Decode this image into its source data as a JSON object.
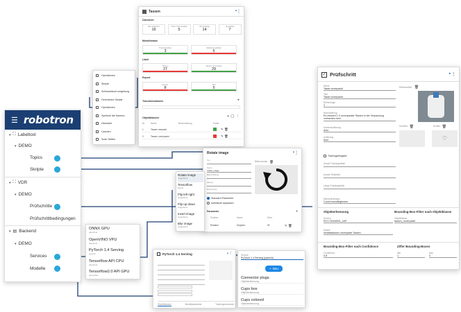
{
  "sidebar": {
    "brand": "robotron",
    "sections": [
      {
        "label": "Labeltool",
        "sub": "DEMO",
        "items": [
          "Topics",
          "Skripte"
        ]
      },
      {
        "label": "VDR",
        "sub": "DEMO",
        "items": [
          "Prüfschritte",
          "Prüfschrittbedingungen"
        ]
      },
      {
        "label": "Backend",
        "sub": "DEMO",
        "items": [
          "Services",
          "Modelle"
        ]
      }
    ]
  },
  "menu": {
    "items": [
      "Operationen",
      "Skripte",
      "Schlüsselwort umgebung",
      "Generische Skripte",
      "Operationen",
      "Symbole die Kamera",
      "Übersicht",
      "Löschen",
      "Scan Stellen"
    ]
  },
  "tassen": {
    "title": "Tassen",
    "section_overview": "Übersicht",
    "stats": [
      {
        "label": "Alle markierten",
        "value": "16"
      },
      {
        "label": "Noch nicht bestätigt",
        "value": "5"
      },
      {
        "label": "Alle bestätigt",
        "value": "14"
      },
      {
        "label": "Ungelabelt",
        "value": "7"
      }
    ],
    "section_model": "Modellstatus",
    "row1": [
      {
        "label": "Trainingsbilder",
        "value": "3"
      },
      {
        "label": "Validierungsbilder",
        "value": "5"
      }
    ],
    "section_label": "Label",
    "row2": [
      {
        "label": "Tassen",
        "value": "27"
      },
      {
        "label": "Tassen unverpackt",
        "value": "29"
      }
    ],
    "section_export": "Export",
    "row3": [
      {
        "label": "Export",
        "value": "8"
      },
      {
        "label": "Test",
        "value": "5"
      }
    ],
    "section_transform": "Transformationen",
    "objects_title": "Objektklassen",
    "objects_cols": [
      "Nr.",
      "Name",
      "Beschreibung",
      "Farbe"
    ],
    "objects": [
      {
        "nr": "1",
        "name": "Tassen verpackt",
        "color": "#43a047"
      },
      {
        "nr": "2",
        "name": "Tassen unverpackt",
        "color": "#e53935"
      }
    ]
  },
  "pruef": {
    "title": "Prüfschritt",
    "fields": [
      {
        "label": "Name",
        "value": "Tasse unverpackt"
      },
      {
        "label": "Titel",
        "value": "Tasse unverpackt"
      },
      {
        "label": "Reihenfolge",
        "value": "2"
      },
      {
        "label": "Beschreibung",
        "value": "Es müssen 1-3 unverpackte Tassen in der Verpackung vorhanden sein."
      },
      {
        "label": "Kameraauflösung",
        "value": "Auto"
      },
      {
        "label": "Auflösung",
        "value": "Auto"
      }
    ],
    "checkbox_label": "Trainingsfreigabe",
    "num_fields": [
      "Anzahl Trainingsbilder",
      "Anzahl Testbilder",
      "Länge Trainingsbilder"
    ],
    "select_label": "Bildverarbeitung",
    "select_value": "Count boundingboxes",
    "image_label": "Referenzbild",
    "img2_label": "Soll-Bild",
    "img3_label": "Ist-Bild",
    "obj_title": "Objekterkennung",
    "obj_fields": [
      {
        "label": "Service",
        "value": "RCV-TEAM001_LMF"
      },
      {
        "label": "Modell",
        "value": "Inhaltsklassen unverpackt Tassen"
      }
    ],
    "bb_title": "Bounding-Box-Filter nach Objektklasse",
    "bb_field": {
      "label": "Objektklasse",
      "value": "tassen_unverpackt"
    },
    "conf_title": "Bounding-Box-Filter nach Confidence",
    "conf_field": {
      "label": "Confidence",
      "value": "0.8"
    },
    "count_title": "Ziffer Bounding-Boxes",
    "count_fields": [
      {
        "label": "Min",
        "value": "1"
      },
      {
        "label": "Max",
        "value": "3"
      }
    ]
  },
  "rotate": {
    "title": "Rotate image",
    "fields": [
      "Typ",
      "Name",
      "Beschreibung",
      "Version",
      "Kommentar"
    ],
    "values": [
      "",
      "rotate_image",
      "",
      "",
      ""
    ],
    "radio1": "Standard Parameter",
    "radio2": "Individuell anpassen",
    "params_title": "Parameter",
    "param_cols": [
      "Position",
      "Name",
      "Wert"
    ],
    "param_row": [
      "Rotation",
      "Degrees",
      "90"
    ],
    "side_label": "Bildvorschau",
    "list": [
      {
        "name": "Rotate image",
        "sub": "ImageStore"
      },
      {
        "name": "Tensorflow",
        "sub": "Export"
      },
      {
        "name": "Flip left right",
        "sub": "ImageStore"
      },
      {
        "name": "Flip up down",
        "sub": "ImageStore"
      },
      {
        "name": "Invert image",
        "sub": "ImageStore"
      },
      {
        "name": "Blur image",
        "sub": "ImageStore"
      }
    ]
  },
  "services": [
    {
      "name": "ONNX GPU",
      "sub": "detectnet"
    },
    {
      "name": "OpenVINO VPU",
      "sub": "detectnet"
    },
    {
      "name": "PyTorch 1.4 Serving",
      "sub": "pytorch"
    },
    {
      "name": "Tensorflow API CPU",
      "sub": "detectnet"
    },
    {
      "name": "Tensorflow2.0 API GPU",
      "sub": "tensorflow"
    }
  ],
  "pytorch": {
    "title": "PyTorch 1.4 Serving",
    "tabs": [
      "Objektklassen",
      "Modellparameter",
      "Trainingsversionen"
    ]
  },
  "models": {
    "field_label": "Service",
    "field_value": "PyTorch 1.4 Serving (pytorch)",
    "new_label": "Neu",
    "items": [
      {
        "name": "Connector plugs",
        "sub": "Objekterkennung"
      },
      {
        "name": "Cups box",
        "sub": "Objekterkennung"
      },
      {
        "name": "Cups colored",
        "sub": "Objekterkennung"
      }
    ]
  }
}
